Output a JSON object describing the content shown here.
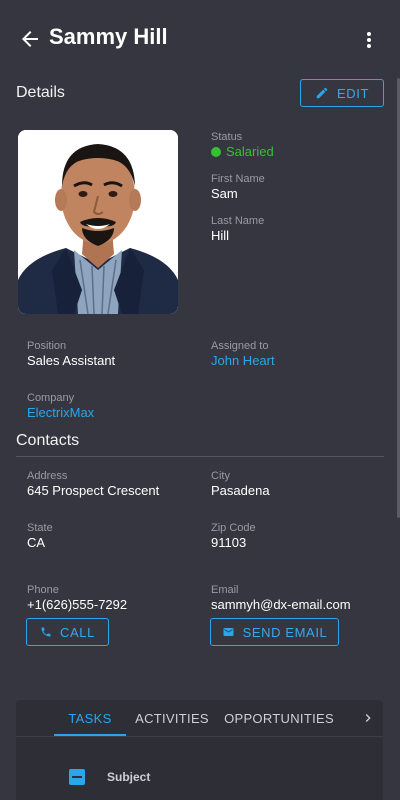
{
  "header": {
    "title": "Sammy Hill"
  },
  "details": {
    "title": "Details",
    "edit_label": "EDIT",
    "status_label": "Status",
    "status_value": "Salaried",
    "first_name_label": "First Name",
    "first_name": "Sam",
    "last_name_label": "Last Name",
    "last_name": "Hill",
    "position_label": "Position",
    "position": "Sales Assistant",
    "assigned_label": "Assigned to",
    "assigned": "John Heart",
    "company_label": "Company",
    "company": "ElectrixMax"
  },
  "contacts": {
    "title": "Contacts",
    "address_label": "Address",
    "address": "645 Prospect Crescent",
    "city_label": "City",
    "city": "Pasadena",
    "state_label": "State",
    "state": "CA",
    "zip_label": "Zip Code",
    "zip": "91103",
    "phone_label": "Phone",
    "phone": "+1(626)555-7292",
    "email_label": "Email",
    "email": "sammyh@dx-email.com",
    "call_label": "CALL",
    "send_email_label": "SEND EMAIL"
  },
  "tabs": {
    "items": [
      "TASKS",
      "ACTIVITIES",
      "OPPORTUNITIES"
    ],
    "active": "TASKS",
    "column_header": "Subject"
  },
  "colors": {
    "background": "#363640",
    "accent": "#2aa6ea",
    "status_green": "#35c232"
  }
}
